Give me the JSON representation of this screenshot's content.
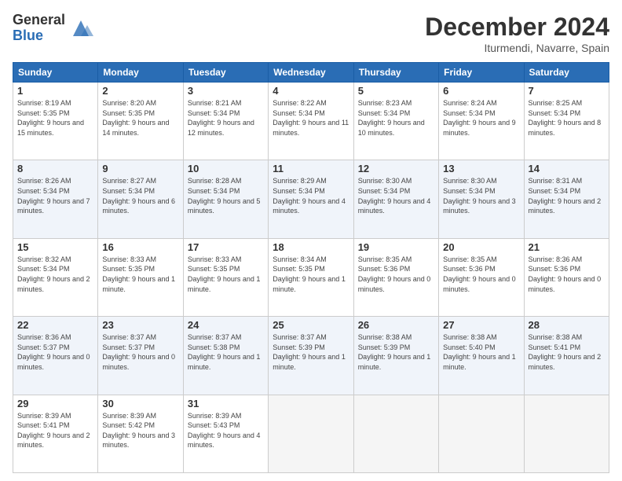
{
  "logo": {
    "general": "General",
    "blue": "Blue"
  },
  "header": {
    "title": "December 2024",
    "location": "Iturmendi, Navarre, Spain"
  },
  "weekdays": [
    "Sunday",
    "Monday",
    "Tuesday",
    "Wednesday",
    "Thursday",
    "Friday",
    "Saturday"
  ],
  "weeks": [
    [
      {
        "day": "1",
        "sunrise": "8:19 AM",
        "sunset": "5:35 PM",
        "daylight": "9 hours and 15 minutes."
      },
      {
        "day": "2",
        "sunrise": "8:20 AM",
        "sunset": "5:35 PM",
        "daylight": "9 hours and 14 minutes."
      },
      {
        "day": "3",
        "sunrise": "8:21 AM",
        "sunset": "5:34 PM",
        "daylight": "9 hours and 12 minutes."
      },
      {
        "day": "4",
        "sunrise": "8:22 AM",
        "sunset": "5:34 PM",
        "daylight": "9 hours and 11 minutes."
      },
      {
        "day": "5",
        "sunrise": "8:23 AM",
        "sunset": "5:34 PM",
        "daylight": "9 hours and 10 minutes."
      },
      {
        "day": "6",
        "sunrise": "8:24 AM",
        "sunset": "5:34 PM",
        "daylight": "9 hours and 9 minutes."
      },
      {
        "day": "7",
        "sunrise": "8:25 AM",
        "sunset": "5:34 PM",
        "daylight": "9 hours and 8 minutes."
      }
    ],
    [
      {
        "day": "8",
        "sunrise": "8:26 AM",
        "sunset": "5:34 PM",
        "daylight": "9 hours and 7 minutes."
      },
      {
        "day": "9",
        "sunrise": "8:27 AM",
        "sunset": "5:34 PM",
        "daylight": "9 hours and 6 minutes."
      },
      {
        "day": "10",
        "sunrise": "8:28 AM",
        "sunset": "5:34 PM",
        "daylight": "9 hours and 5 minutes."
      },
      {
        "day": "11",
        "sunrise": "8:29 AM",
        "sunset": "5:34 PM",
        "daylight": "9 hours and 4 minutes."
      },
      {
        "day": "12",
        "sunrise": "8:30 AM",
        "sunset": "5:34 PM",
        "daylight": "9 hours and 4 minutes."
      },
      {
        "day": "13",
        "sunrise": "8:30 AM",
        "sunset": "5:34 PM",
        "daylight": "9 hours and 3 minutes."
      },
      {
        "day": "14",
        "sunrise": "8:31 AM",
        "sunset": "5:34 PM",
        "daylight": "9 hours and 2 minutes."
      }
    ],
    [
      {
        "day": "15",
        "sunrise": "8:32 AM",
        "sunset": "5:34 PM",
        "daylight": "9 hours and 2 minutes."
      },
      {
        "day": "16",
        "sunrise": "8:33 AM",
        "sunset": "5:35 PM",
        "daylight": "9 hours and 1 minute."
      },
      {
        "day": "17",
        "sunrise": "8:33 AM",
        "sunset": "5:35 PM",
        "daylight": "9 hours and 1 minute."
      },
      {
        "day": "18",
        "sunrise": "8:34 AM",
        "sunset": "5:35 PM",
        "daylight": "9 hours and 1 minute."
      },
      {
        "day": "19",
        "sunrise": "8:35 AM",
        "sunset": "5:36 PM",
        "daylight": "9 hours and 0 minutes."
      },
      {
        "day": "20",
        "sunrise": "8:35 AM",
        "sunset": "5:36 PM",
        "daylight": "9 hours and 0 minutes."
      },
      {
        "day": "21",
        "sunrise": "8:36 AM",
        "sunset": "5:36 PM",
        "daylight": "9 hours and 0 minutes."
      }
    ],
    [
      {
        "day": "22",
        "sunrise": "8:36 AM",
        "sunset": "5:37 PM",
        "daylight": "9 hours and 0 minutes."
      },
      {
        "day": "23",
        "sunrise": "8:37 AM",
        "sunset": "5:37 PM",
        "daylight": "9 hours and 0 minutes."
      },
      {
        "day": "24",
        "sunrise": "8:37 AM",
        "sunset": "5:38 PM",
        "daylight": "9 hours and 1 minute."
      },
      {
        "day": "25",
        "sunrise": "8:37 AM",
        "sunset": "5:39 PM",
        "daylight": "9 hours and 1 minute."
      },
      {
        "day": "26",
        "sunrise": "8:38 AM",
        "sunset": "5:39 PM",
        "daylight": "9 hours and 1 minute."
      },
      {
        "day": "27",
        "sunrise": "8:38 AM",
        "sunset": "5:40 PM",
        "daylight": "9 hours and 1 minute."
      },
      {
        "day": "28",
        "sunrise": "8:38 AM",
        "sunset": "5:41 PM",
        "daylight": "9 hours and 2 minutes."
      }
    ],
    [
      {
        "day": "29",
        "sunrise": "8:39 AM",
        "sunset": "5:41 PM",
        "daylight": "9 hours and 2 minutes."
      },
      {
        "day": "30",
        "sunrise": "8:39 AM",
        "sunset": "5:42 PM",
        "daylight": "9 hours and 3 minutes."
      },
      {
        "day": "31",
        "sunrise": "8:39 AM",
        "sunset": "5:43 PM",
        "daylight": "9 hours and 4 minutes."
      },
      null,
      null,
      null,
      null
    ]
  ]
}
